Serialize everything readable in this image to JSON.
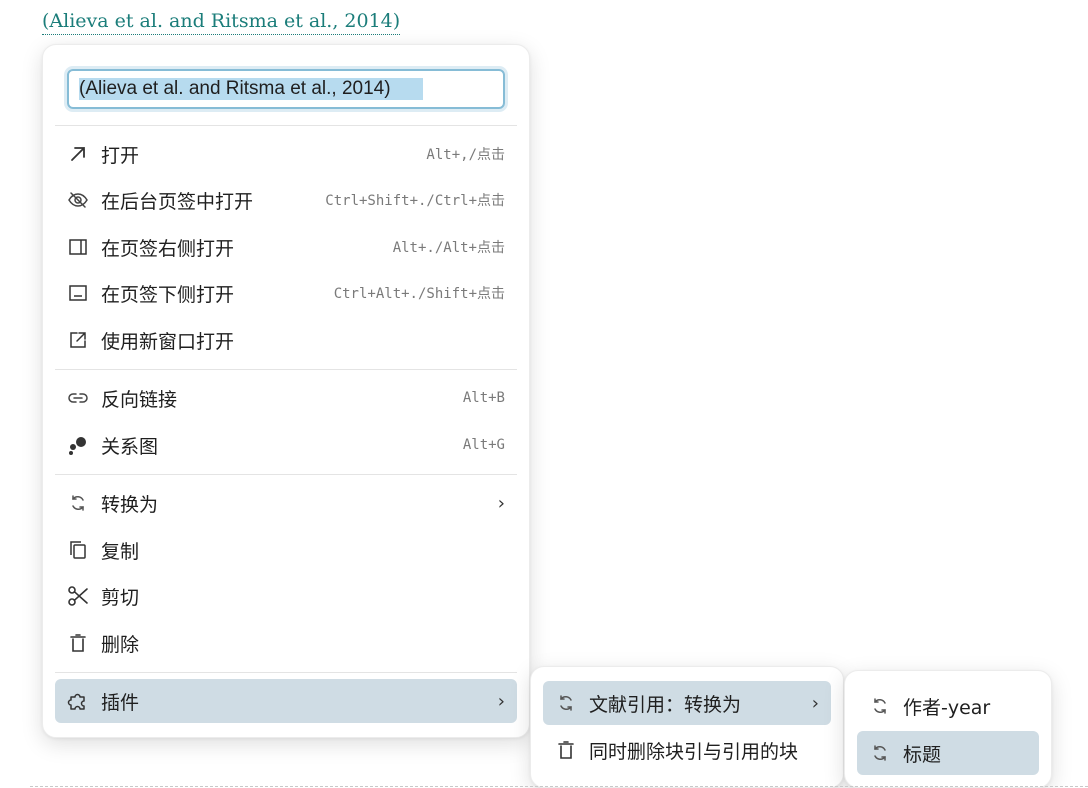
{
  "citation": {
    "text": "(Alieva et al. and Ritsma et al., 2014)"
  },
  "menu": {
    "rename_value": "(Alieva et al. and Ritsma et al., 2014)",
    "items": [
      {
        "label": "打开",
        "shortcut": "Alt+,/点击",
        "icon": "arrow-up-right-icon"
      },
      {
        "label": "在后台页签中打开",
        "shortcut": "Ctrl+Shift+./Ctrl+点击",
        "icon": "eye-off-icon"
      },
      {
        "label": "在页签右侧打开",
        "shortcut": "Alt+./Alt+点击",
        "icon": "split-right-icon"
      },
      {
        "label": "在页签下侧打开",
        "shortcut": "Ctrl+Alt+./Shift+点击",
        "icon": "split-bottom-icon"
      },
      {
        "label": "使用新窗口打开",
        "icon": "external-window-icon"
      },
      {
        "label": "反向链接",
        "shortcut": "Alt+B",
        "icon": "link-icon"
      },
      {
        "label": "关系图",
        "shortcut": "Alt+G",
        "icon": "graph-icon"
      },
      {
        "label": "转换为",
        "icon": "convert-icon"
      },
      {
        "label": "复制",
        "icon": "copy-icon"
      },
      {
        "label": "剪切",
        "icon": "scissors-icon"
      },
      {
        "label": "删除",
        "icon": "trash-icon"
      },
      {
        "label": "插件",
        "icon": "plugin-icon"
      }
    ]
  },
  "submenu": {
    "items": [
      {
        "label": "文献引用：转换为",
        "icon": "convert-icon"
      },
      {
        "label": "同时删除块引与引用的块",
        "icon": "trash-icon"
      }
    ]
  },
  "subsubmenu": {
    "items": [
      {
        "label": "作者-year",
        "icon": "convert-icon"
      },
      {
        "label": "标题",
        "icon": "convert-icon"
      }
    ]
  },
  "colors": {
    "accent": "#1b7d7a",
    "active_bg": "#cfdce4",
    "focus_border": "#86bcd6"
  }
}
